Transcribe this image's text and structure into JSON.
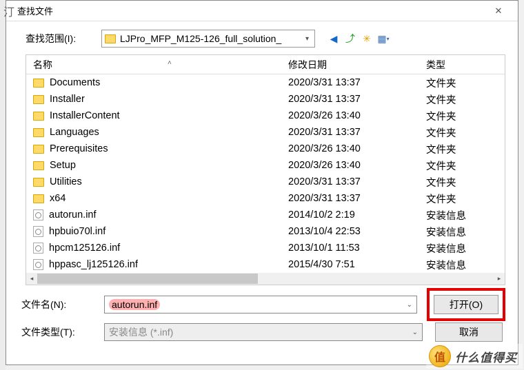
{
  "titlebar": {
    "prefix": "汀",
    "title": "查找文件"
  },
  "lookin": {
    "label": "查找范围(I):",
    "value": "LJPro_MFP_M125-126_full_solution_"
  },
  "columns": {
    "name": "名称",
    "date": "修改日期",
    "type": "类型"
  },
  "type_labels": {
    "folder": "文件夹",
    "inf": "安装信息"
  },
  "files": [
    {
      "name": "Documents",
      "date": "2020/3/31 13:37",
      "kind": "folder"
    },
    {
      "name": "Installer",
      "date": "2020/3/31 13:37",
      "kind": "folder"
    },
    {
      "name": "InstallerContent",
      "date": "2020/3/26 13:40",
      "kind": "folder"
    },
    {
      "name": "Languages",
      "date": "2020/3/31 13:37",
      "kind": "folder"
    },
    {
      "name": "Prerequisites",
      "date": "2020/3/26 13:40",
      "kind": "folder"
    },
    {
      "name": "Setup",
      "date": "2020/3/26 13:40",
      "kind": "folder"
    },
    {
      "name": "Utilities",
      "date": "2020/3/31 13:37",
      "kind": "folder"
    },
    {
      "name": "x64",
      "date": "2020/3/31 13:37",
      "kind": "folder"
    },
    {
      "name": "autorun.inf",
      "date": "2014/10/2 2:19",
      "kind": "inf"
    },
    {
      "name": "hpbuio70l.inf",
      "date": "2013/10/4 22:53",
      "kind": "inf"
    },
    {
      "name": "hpcm125126.inf",
      "date": "2013/10/1 11:53",
      "kind": "inf"
    },
    {
      "name": "hppasc_lj125126.inf",
      "date": "2015/4/30 7:51",
      "kind": "inf"
    }
  ],
  "filename": {
    "label": "文件名(N):",
    "value": "autorun.inf"
  },
  "filetype": {
    "label": "文件类型(T):",
    "value": "安装信息 (*.inf)"
  },
  "buttons": {
    "open": "打开(O)",
    "cancel": "取消"
  },
  "watermark": "什么值得买"
}
